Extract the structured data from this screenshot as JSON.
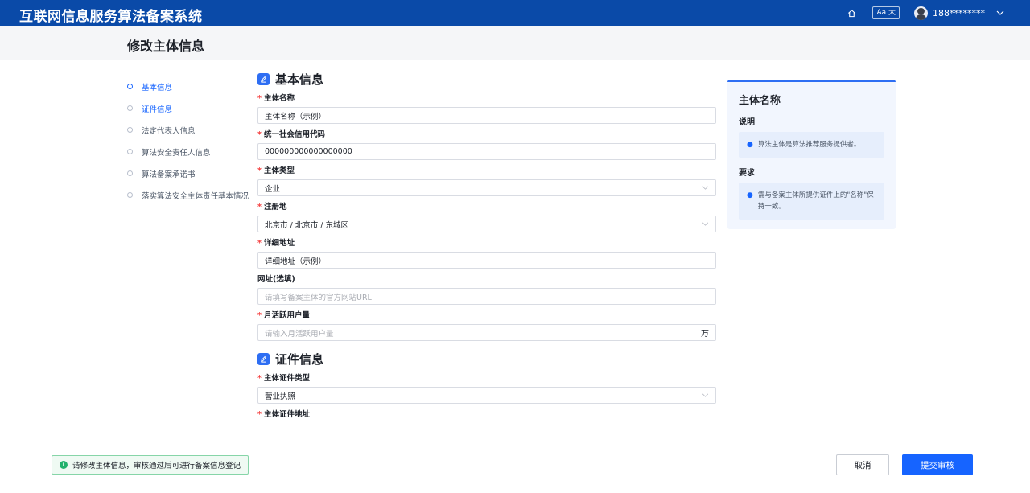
{
  "header": {
    "app_title": "互联网信息服务算法备案系统",
    "font_toggle": "Aa 大",
    "username": "188********"
  },
  "page": {
    "title": "修改主体信息"
  },
  "steps": [
    {
      "label": "基本信息",
      "state": "active"
    },
    {
      "label": "证件信息",
      "state": "link"
    },
    {
      "label": "法定代表人信息",
      "state": "default"
    },
    {
      "label": "算法安全责任人信息",
      "state": "default"
    },
    {
      "label": "算法备案承诺书",
      "state": "default"
    },
    {
      "label": "落实算法安全主体责任基本情况",
      "state": "default"
    }
  ],
  "sections": {
    "basic": {
      "title": "基本信息",
      "fields": {
        "name": {
          "label": "主体名称",
          "value": "主体名称（示例）"
        },
        "credit_code": {
          "label": "统一社会信用代码",
          "value": "000000000000000000"
        },
        "type": {
          "label": "主体类型",
          "value": "企业"
        },
        "region": {
          "label": "注册地",
          "value": "北京市 / 北京市 / 东城区"
        },
        "address": {
          "label": "详细地址",
          "value": "详细地址（示例）"
        },
        "website": {
          "label": "网址(选填)",
          "placeholder": "请填写备案主体的官方网站URL"
        },
        "mau": {
          "label": "月活跃用户量",
          "placeholder": "请输入月活跃用户量",
          "suffix": "万"
        }
      }
    },
    "cert": {
      "title": "证件信息",
      "fields": {
        "cert_type": {
          "label": "主体证件类型",
          "value": "营业执照"
        },
        "cert_address": {
          "label": "主体证件地址"
        }
      }
    }
  },
  "help": {
    "title": "主体名称",
    "desc_heading": "说明",
    "desc_text": "算法主体是算法推荐服务提供者。",
    "req_heading": "要求",
    "req_text": "需与备案主体所提供证件上的\"名称\"保持一致。"
  },
  "footer": {
    "notice": "请修改主体信息，审核通过后可进行备案信息登记",
    "cancel_label": "取消",
    "submit_label": "提交审核"
  },
  "colors": {
    "brand_bar": "#0a4aa8",
    "primary": "#1664ff",
    "required": "#f53f3f",
    "success": "#23b26d"
  }
}
